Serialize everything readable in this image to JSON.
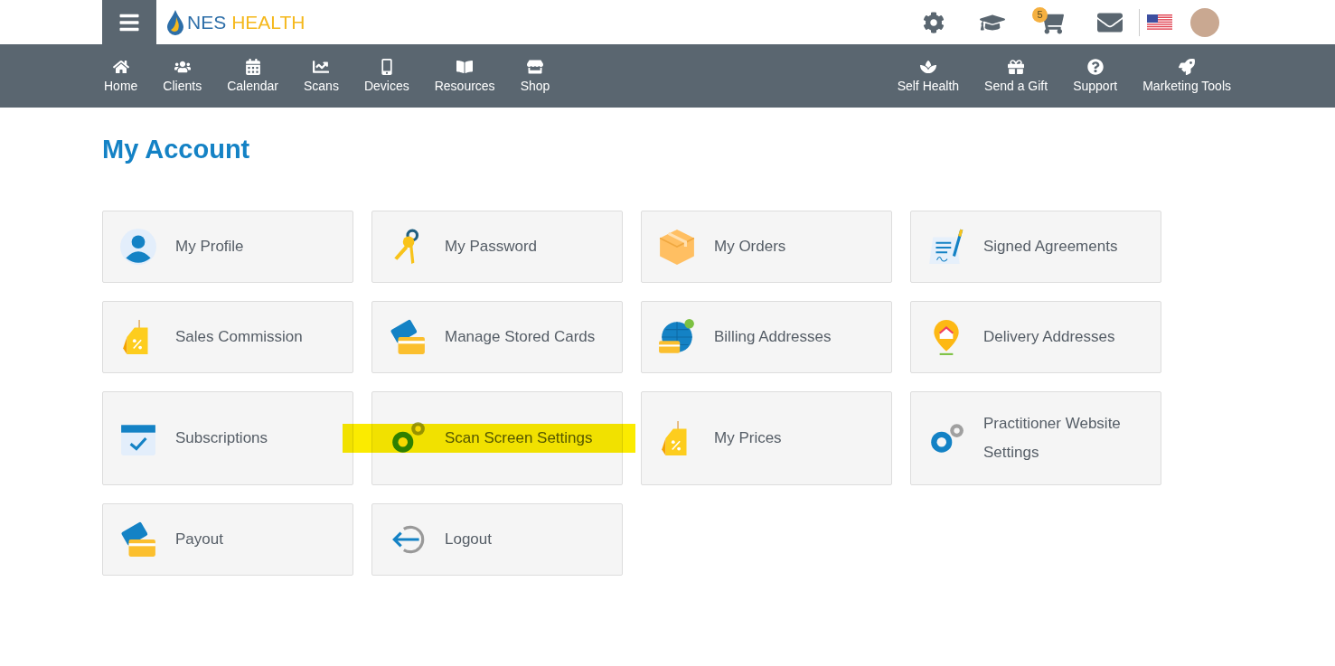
{
  "brand": {
    "name_part1": "NES",
    "name_part2": "HEALTH"
  },
  "cart_badge": "5",
  "nav_left": [
    {
      "label": "Home"
    },
    {
      "label": "Clients"
    },
    {
      "label": "Calendar"
    },
    {
      "label": "Scans"
    },
    {
      "label": "Devices"
    },
    {
      "label": "Resources"
    },
    {
      "label": "Shop"
    }
  ],
  "nav_right": [
    {
      "label": "Self Health"
    },
    {
      "label": "Send a Gift"
    },
    {
      "label": "Support"
    },
    {
      "label": "Marketing Tools"
    }
  ],
  "page_title": "My Account",
  "cards": [
    {
      "label": "My Profile",
      "highlighted": false
    },
    {
      "label": "My Password",
      "highlighted": false
    },
    {
      "label": "My Orders",
      "highlighted": false
    },
    {
      "label": "Signed Agreements",
      "highlighted": false
    },
    {
      "label": "Sales Commission",
      "highlighted": false
    },
    {
      "label": "Manage Stored Cards",
      "highlighted": false
    },
    {
      "label": "Billing Addresses",
      "highlighted": false
    },
    {
      "label": "Delivery Addresses",
      "highlighted": false
    },
    {
      "label": "Subscriptions",
      "highlighted": false
    },
    {
      "label": "Scan Screen Settings",
      "highlighted": true
    },
    {
      "label": "My Prices",
      "highlighted": false
    },
    {
      "label": "Practitioner Website Settings",
      "highlighted": false
    },
    {
      "label": "Payout",
      "highlighted": false
    },
    {
      "label": "Logout",
      "highlighted": false
    }
  ]
}
